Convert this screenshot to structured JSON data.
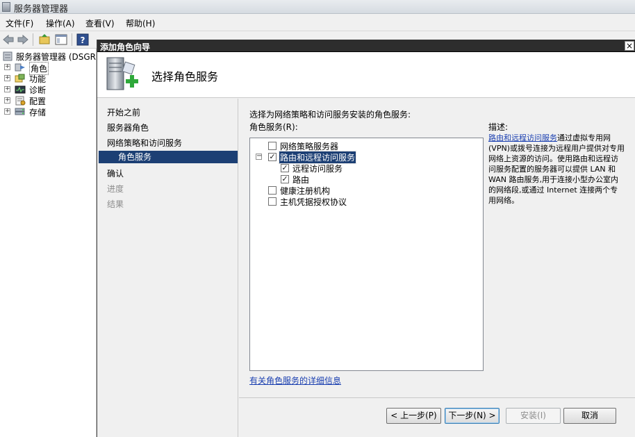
{
  "app": {
    "title": "服务器管理器",
    "menu": [
      "文件(F)",
      "操作(A)",
      "查看(V)",
      "帮助(H)"
    ]
  },
  "tree": {
    "root": "服务器管理器 (DSGRD",
    "items": [
      "角色",
      "功能",
      "诊断",
      "配置",
      "存储"
    ]
  },
  "wizard": {
    "title": "添加角色向导",
    "close": "×",
    "header_title": "选择角色服务",
    "steps": [
      {
        "label": "开始之前"
      },
      {
        "label": "服务器角色"
      },
      {
        "label": "网络策略和访问服务"
      },
      {
        "label": "角色服务"
      },
      {
        "label": "确认"
      },
      {
        "label": "进度"
      },
      {
        "label": "结果"
      }
    ],
    "instruction": "选择为网络策略和访问服务安装的角色服务:",
    "list_label": "角色服务(R):",
    "roles": [
      {
        "label": "网络策略服务器",
        "checked": false
      },
      {
        "label": "路由和远程访问服务",
        "checked": true
      },
      {
        "label": "远程访问服务",
        "checked": true
      },
      {
        "label": "路由",
        "checked": true
      },
      {
        "label": "健康注册机构",
        "checked": false
      },
      {
        "label": "主机凭据授权协议",
        "checked": false
      }
    ],
    "expander_minus": "−",
    "check_mark": "✓",
    "more_info_link": "有关角色服务的详细信息",
    "description_label": "描述:",
    "description_link": "路由和远程访问服务",
    "description_text": "通过虚拟专用网(VPN)或拨号连接为远程用户提供对专用网络上资源的访问。使用路由和远程访问服务配置的服务器可以提供 LAN 和 WAN 路由服务,用于连接小型办公室内的网络段,或通过 Internet 连接两个专用网络。",
    "buttons": {
      "back": "< 上一步(P)",
      "next": "下一步(N) >",
      "install": "安装(I)",
      "cancel": "取消"
    }
  }
}
